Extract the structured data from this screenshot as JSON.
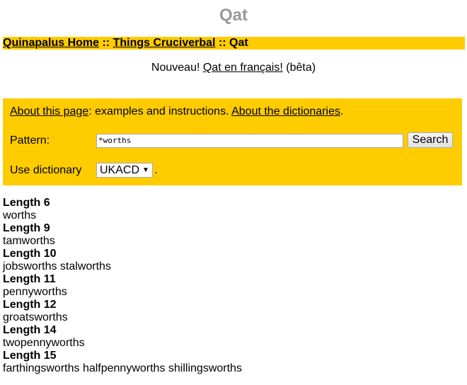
{
  "page": {
    "title": "Qat"
  },
  "breadcrumb": {
    "items": [
      {
        "label": "Quinapalus Home",
        "link": true
      },
      {
        "label": "Things Cruciverbal",
        "link": true
      },
      {
        "label": "Qat",
        "link": false
      }
    ],
    "separator": " :: "
  },
  "notice": {
    "prefix": "Nouveau! ",
    "link_label": "Qat en français!",
    "suffix": " (bêta)"
  },
  "search_box": {
    "about_link": "About this page",
    "about_text": ": examples and instructions. ",
    "dict_link": "About the dictionaries",
    "dict_text_end": ".",
    "pattern_label": "Pattern:",
    "pattern_value": "*worths",
    "search_button": "Search",
    "dictionary_label": "Use dictionary",
    "dictionary_selected": "UKACD",
    "dictionary_suffix": "."
  },
  "results": [
    {
      "heading": "Length 6",
      "words": "worths"
    },
    {
      "heading": "Length 9",
      "words": "tamworths"
    },
    {
      "heading": "Length 10",
      "words": "jobsworths stalworths"
    },
    {
      "heading": "Length 11",
      "words": "pennyworths"
    },
    {
      "heading": "Length 12",
      "words": "groatsworths"
    },
    {
      "heading": "Length 14",
      "words": "twopennyworths"
    },
    {
      "heading": "Length 15",
      "words": "farthingsworths halfpennyworths shillingsworths"
    }
  ],
  "colors": {
    "accent": "#ffcc00",
    "title": "#999999"
  }
}
